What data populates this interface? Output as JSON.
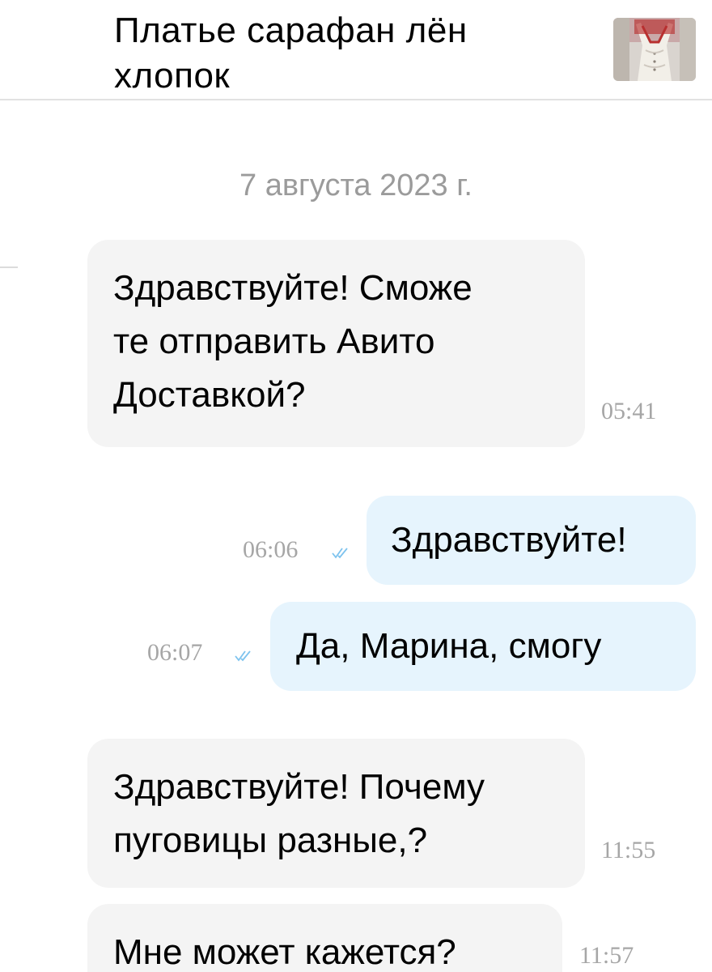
{
  "header": {
    "title": "Платье сарафан лён хлопок",
    "thumbnail_icon": "dress-thumbnail"
  },
  "date_separator": "7 августа 2023 г.",
  "colors": {
    "incoming_bubble": "#f4f4f4",
    "outgoing_bubble": "#e6f4fd",
    "timestamp": "#a6a6a6",
    "read_check": "#7ec3ee",
    "date_text": "#9b9b9b"
  },
  "messages": [
    {
      "direction": "in",
      "text": "Здравствуйте! Сможе\nте отправить Авито\nДоставкой?",
      "time": "05:41"
    },
    {
      "direction": "out",
      "text": "Здравствуйте!",
      "time": "06:06",
      "status": "read-check-icon"
    },
    {
      "direction": "out",
      "text": "Да, Марина, смогу",
      "time": "06:07",
      "status": "read-check-icon"
    },
    {
      "direction": "in",
      "text": "Здравствуйте! Почему\nпуговицы разные,?",
      "time": "11:55"
    },
    {
      "direction": "in",
      "text": "Мне может кажется?",
      "time": "11:57"
    }
  ]
}
